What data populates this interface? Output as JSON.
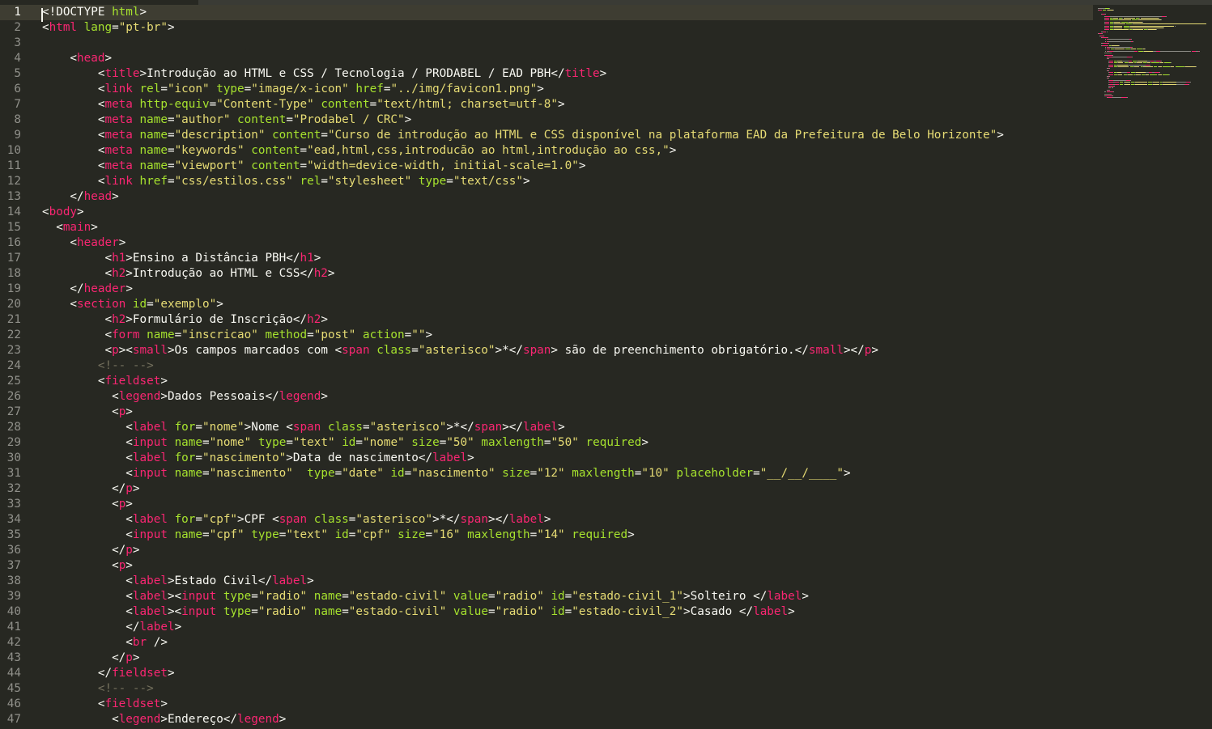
{
  "lines": [
    [
      [
        "t",
        "<!DOCTYPE "
      ],
      [
        "c",
        "html"
      ],
      [
        "t",
        ">"
      ]
    ],
    [
      [
        "t",
        "<"
      ],
      [
        "k",
        "html"
      ],
      [
        "t",
        " "
      ],
      [
        "a",
        "lang"
      ],
      [
        "t",
        "="
      ],
      [
        "s",
        "\"pt-br\""
      ],
      [
        "t",
        ">"
      ]
    ],
    [],
    [
      [
        "t",
        "    <"
      ],
      [
        "k",
        "head"
      ],
      [
        "t",
        ">"
      ]
    ],
    [
      [
        "t",
        "        <"
      ],
      [
        "k",
        "title"
      ],
      [
        "t",
        ">Introdução ao HTML e CSS / Tecnologia / PRODABEL / EAD PBH</"
      ],
      [
        "k",
        "title"
      ],
      [
        "t",
        ">"
      ]
    ],
    [
      [
        "t",
        "        <"
      ],
      [
        "k",
        "link"
      ],
      [
        "t",
        " "
      ],
      [
        "a",
        "rel"
      ],
      [
        "t",
        "="
      ],
      [
        "s",
        "\"icon\""
      ],
      [
        "t",
        " "
      ],
      [
        "a",
        "type"
      ],
      [
        "t",
        "="
      ],
      [
        "s",
        "\"image/x-icon\""
      ],
      [
        "t",
        " "
      ],
      [
        "a",
        "href"
      ],
      [
        "t",
        "="
      ],
      [
        "s",
        "\"../img/favicon1.png\""
      ],
      [
        "t",
        ">"
      ]
    ],
    [
      [
        "t",
        "        <"
      ],
      [
        "k",
        "meta"
      ],
      [
        "t",
        " "
      ],
      [
        "a",
        "http-equiv"
      ],
      [
        "t",
        "="
      ],
      [
        "s",
        "\"Content-Type\""
      ],
      [
        "t",
        " "
      ],
      [
        "a",
        "content"
      ],
      [
        "t",
        "="
      ],
      [
        "s",
        "\"text/html; charset=utf-8\""
      ],
      [
        "t",
        ">"
      ]
    ],
    [
      [
        "t",
        "        <"
      ],
      [
        "k",
        "meta"
      ],
      [
        "t",
        " "
      ],
      [
        "a",
        "name"
      ],
      [
        "t",
        "="
      ],
      [
        "s",
        "\"author\""
      ],
      [
        "t",
        " "
      ],
      [
        "a",
        "content"
      ],
      [
        "t",
        "="
      ],
      [
        "s",
        "\"Prodabel / CRC\""
      ],
      [
        "t",
        ">"
      ]
    ],
    [
      [
        "t",
        "        <"
      ],
      [
        "k",
        "meta"
      ],
      [
        "t",
        " "
      ],
      [
        "a",
        "name"
      ],
      [
        "t",
        "="
      ],
      [
        "s",
        "\"description\""
      ],
      [
        "t",
        " "
      ],
      [
        "a",
        "content"
      ],
      [
        "t",
        "="
      ],
      [
        "s",
        "\"Curso de introdução ao HTML e CSS disponível na plataforma EAD da Prefeitura de Belo Horizonte\""
      ],
      [
        "t",
        ">"
      ]
    ],
    [
      [
        "t",
        "        <"
      ],
      [
        "k",
        "meta"
      ],
      [
        "t",
        " "
      ],
      [
        "a",
        "name"
      ],
      [
        "t",
        "="
      ],
      [
        "s",
        "\"keywords\""
      ],
      [
        "t",
        " "
      ],
      [
        "a",
        "content"
      ],
      [
        "t",
        "="
      ],
      [
        "s",
        "\"ead,html,css,introducão ao html,introdução ao css,\""
      ],
      [
        "t",
        ">"
      ]
    ],
    [
      [
        "t",
        "        <"
      ],
      [
        "k",
        "meta"
      ],
      [
        "t",
        " "
      ],
      [
        "a",
        "name"
      ],
      [
        "t",
        "="
      ],
      [
        "s",
        "\"viewport\""
      ],
      [
        "t",
        " "
      ],
      [
        "a",
        "content"
      ],
      [
        "t",
        "="
      ],
      [
        "s",
        "\"width=device-width, initial-scale=1.0\""
      ],
      [
        "t",
        ">"
      ]
    ],
    [
      [
        "t",
        "        <"
      ],
      [
        "k",
        "link"
      ],
      [
        "t",
        " "
      ],
      [
        "a",
        "href"
      ],
      [
        "t",
        "="
      ],
      [
        "s",
        "\"css/estilos.css\""
      ],
      [
        "t",
        " "
      ],
      [
        "a",
        "rel"
      ],
      [
        "t",
        "="
      ],
      [
        "s",
        "\"stylesheet\""
      ],
      [
        "t",
        " "
      ],
      [
        "a",
        "type"
      ],
      [
        "t",
        "="
      ],
      [
        "s",
        "\"text/css\""
      ],
      [
        "t",
        ">"
      ]
    ],
    [
      [
        "t",
        "    </"
      ],
      [
        "k",
        "head"
      ],
      [
        "t",
        ">"
      ]
    ],
    [
      [
        "t",
        "<"
      ],
      [
        "k",
        "body"
      ],
      [
        "t",
        ">"
      ]
    ],
    [
      [
        "t",
        "  <"
      ],
      [
        "k",
        "main"
      ],
      [
        "t",
        ">"
      ]
    ],
    [
      [
        "t",
        "    <"
      ],
      [
        "k",
        "header"
      ],
      [
        "t",
        ">"
      ]
    ],
    [
      [
        "t",
        "         <"
      ],
      [
        "k",
        "h1"
      ],
      [
        "t",
        ">Ensino a Distância PBH</"
      ],
      [
        "k",
        "h1"
      ],
      [
        "t",
        ">"
      ]
    ],
    [
      [
        "t",
        "         <"
      ],
      [
        "k",
        "h2"
      ],
      [
        "t",
        ">Introdução ao HTML e CSS</"
      ],
      [
        "k",
        "h2"
      ],
      [
        "t",
        ">"
      ]
    ],
    [
      [
        "t",
        "    </"
      ],
      [
        "k",
        "header"
      ],
      [
        "t",
        ">"
      ]
    ],
    [
      [
        "t",
        "    <"
      ],
      [
        "k",
        "section"
      ],
      [
        "t",
        " "
      ],
      [
        "a",
        "id"
      ],
      [
        "t",
        "="
      ],
      [
        "s",
        "\"exemplo\""
      ],
      [
        "t",
        ">"
      ]
    ],
    [
      [
        "t",
        "         <"
      ],
      [
        "k",
        "h2"
      ],
      [
        "t",
        ">Formulário de Inscrição</"
      ],
      [
        "k",
        "h2"
      ],
      [
        "t",
        ">"
      ]
    ],
    [
      [
        "t",
        "         <"
      ],
      [
        "k",
        "form"
      ],
      [
        "t",
        " "
      ],
      [
        "a",
        "name"
      ],
      [
        "t",
        "="
      ],
      [
        "s",
        "\"inscricao\""
      ],
      [
        "t",
        " "
      ],
      [
        "a",
        "method"
      ],
      [
        "t",
        "="
      ],
      [
        "s",
        "\"post\""
      ],
      [
        "t",
        " "
      ],
      [
        "a",
        "action"
      ],
      [
        "t",
        "="
      ],
      [
        "s",
        "\"\""
      ],
      [
        "t",
        ">"
      ]
    ],
    [
      [
        "t",
        "         <"
      ],
      [
        "k",
        "p"
      ],
      [
        "t",
        "><"
      ],
      [
        "k",
        "small"
      ],
      [
        "t",
        ">Os campos marcados com <"
      ],
      [
        "k",
        "span"
      ],
      [
        "t",
        " "
      ],
      [
        "a",
        "class"
      ],
      [
        "t",
        "="
      ],
      [
        "s",
        "\"asterisco\""
      ],
      [
        "t",
        ">*</"
      ],
      [
        "k",
        "span"
      ],
      [
        "t",
        "> são de preenchimento obrigatório.</"
      ],
      [
        "k",
        "small"
      ],
      [
        "t",
        "></"
      ],
      [
        "k",
        "p"
      ],
      [
        "t",
        ">"
      ]
    ],
    [
      [
        "m",
        "        <!-- -->"
      ]
    ],
    [
      [
        "t",
        "        <"
      ],
      [
        "k",
        "fieldset"
      ],
      [
        "t",
        ">"
      ]
    ],
    [
      [
        "t",
        "          <"
      ],
      [
        "k",
        "legend"
      ],
      [
        "t",
        ">Dados Pessoais</"
      ],
      [
        "k",
        "legend"
      ],
      [
        "t",
        ">"
      ]
    ],
    [
      [
        "t",
        "          <"
      ],
      [
        "k",
        "p"
      ],
      [
        "t",
        ">"
      ]
    ],
    [
      [
        "t",
        "            <"
      ],
      [
        "k",
        "label"
      ],
      [
        "t",
        " "
      ],
      [
        "a",
        "for"
      ],
      [
        "t",
        "="
      ],
      [
        "s",
        "\"nome\""
      ],
      [
        "t",
        ">Nome <"
      ],
      [
        "k",
        "span"
      ],
      [
        "t",
        " "
      ],
      [
        "a",
        "class"
      ],
      [
        "t",
        "="
      ],
      [
        "s",
        "\"asterisco\""
      ],
      [
        "t",
        ">*</"
      ],
      [
        "k",
        "span"
      ],
      [
        "t",
        "></"
      ],
      [
        "k",
        "label"
      ],
      [
        "t",
        ">"
      ]
    ],
    [
      [
        "t",
        "            <"
      ],
      [
        "k",
        "input"
      ],
      [
        "t",
        " "
      ],
      [
        "a",
        "name"
      ],
      [
        "t",
        "="
      ],
      [
        "s",
        "\"nome\""
      ],
      [
        "t",
        " "
      ],
      [
        "a",
        "type"
      ],
      [
        "t",
        "="
      ],
      [
        "s",
        "\"text\""
      ],
      [
        "t",
        " "
      ],
      [
        "a",
        "id"
      ],
      [
        "t",
        "="
      ],
      [
        "s",
        "\"nome\""
      ],
      [
        "t",
        " "
      ],
      [
        "a",
        "size"
      ],
      [
        "t",
        "="
      ],
      [
        "s",
        "\"50\""
      ],
      [
        "t",
        " "
      ],
      [
        "a",
        "maxlength"
      ],
      [
        "t",
        "="
      ],
      [
        "s",
        "\"50\""
      ],
      [
        "t",
        " "
      ],
      [
        "a",
        "required"
      ],
      [
        "t",
        ">"
      ]
    ],
    [
      [
        "t",
        "            <"
      ],
      [
        "k",
        "label"
      ],
      [
        "t",
        " "
      ],
      [
        "a",
        "for"
      ],
      [
        "t",
        "="
      ],
      [
        "s",
        "\"nascimento\""
      ],
      [
        "t",
        ">Data de nascimento</"
      ],
      [
        "k",
        "label"
      ],
      [
        "t",
        ">"
      ]
    ],
    [
      [
        "t",
        "            <"
      ],
      [
        "k",
        "input"
      ],
      [
        "t",
        " "
      ],
      [
        "a",
        "name"
      ],
      [
        "t",
        "="
      ],
      [
        "s",
        "\"nascimento\""
      ],
      [
        "t",
        "  "
      ],
      [
        "a",
        "type"
      ],
      [
        "t",
        "="
      ],
      [
        "s",
        "\"date\""
      ],
      [
        "t",
        " "
      ],
      [
        "a",
        "id"
      ],
      [
        "t",
        "="
      ],
      [
        "s",
        "\"nascimento\""
      ],
      [
        "t",
        " "
      ],
      [
        "a",
        "size"
      ],
      [
        "t",
        "="
      ],
      [
        "s",
        "\"12\""
      ],
      [
        "t",
        " "
      ],
      [
        "a",
        "maxlength"
      ],
      [
        "t",
        "="
      ],
      [
        "s",
        "\"10\""
      ],
      [
        "t",
        " "
      ],
      [
        "a",
        "placeholder"
      ],
      [
        "t",
        "="
      ],
      [
        "s",
        "\"__/__/____\""
      ],
      [
        "t",
        ">"
      ]
    ],
    [
      [
        "t",
        "          </"
      ],
      [
        "k",
        "p"
      ],
      [
        "t",
        ">"
      ]
    ],
    [
      [
        "t",
        "          <"
      ],
      [
        "k",
        "p"
      ],
      [
        "t",
        ">"
      ]
    ],
    [
      [
        "t",
        "            <"
      ],
      [
        "k",
        "label"
      ],
      [
        "t",
        " "
      ],
      [
        "a",
        "for"
      ],
      [
        "t",
        "="
      ],
      [
        "s",
        "\"cpf\""
      ],
      [
        "t",
        ">CPF <"
      ],
      [
        "k",
        "span"
      ],
      [
        "t",
        " "
      ],
      [
        "a",
        "class"
      ],
      [
        "t",
        "="
      ],
      [
        "s",
        "\"asterisco\""
      ],
      [
        "t",
        ">*</"
      ],
      [
        "k",
        "span"
      ],
      [
        "t",
        "></"
      ],
      [
        "k",
        "label"
      ],
      [
        "t",
        ">"
      ]
    ],
    [
      [
        "t",
        "            <"
      ],
      [
        "k",
        "input"
      ],
      [
        "t",
        " "
      ],
      [
        "a",
        "name"
      ],
      [
        "t",
        "="
      ],
      [
        "s",
        "\"cpf\""
      ],
      [
        "t",
        " "
      ],
      [
        "a",
        "type"
      ],
      [
        "t",
        "="
      ],
      [
        "s",
        "\"text\""
      ],
      [
        "t",
        " "
      ],
      [
        "a",
        "id"
      ],
      [
        "t",
        "="
      ],
      [
        "s",
        "\"cpf\""
      ],
      [
        "t",
        " "
      ],
      [
        "a",
        "size"
      ],
      [
        "t",
        "="
      ],
      [
        "s",
        "\"16\""
      ],
      [
        "t",
        " "
      ],
      [
        "a",
        "maxlength"
      ],
      [
        "t",
        "="
      ],
      [
        "s",
        "\"14\""
      ],
      [
        "t",
        " "
      ],
      [
        "a",
        "required"
      ],
      [
        "t",
        ">"
      ]
    ],
    [
      [
        "t",
        "          </"
      ],
      [
        "k",
        "p"
      ],
      [
        "t",
        ">"
      ]
    ],
    [
      [
        "t",
        "          <"
      ],
      [
        "k",
        "p"
      ],
      [
        "t",
        ">"
      ]
    ],
    [
      [
        "t",
        "            <"
      ],
      [
        "k",
        "label"
      ],
      [
        "t",
        ">Estado Civil</"
      ],
      [
        "k",
        "label"
      ],
      [
        "t",
        ">"
      ]
    ],
    [
      [
        "t",
        "            <"
      ],
      [
        "k",
        "label"
      ],
      [
        "t",
        "><"
      ],
      [
        "k",
        "input"
      ],
      [
        "t",
        " "
      ],
      [
        "a",
        "type"
      ],
      [
        "t",
        "="
      ],
      [
        "s",
        "\"radio\""
      ],
      [
        "t",
        " "
      ],
      [
        "a",
        "name"
      ],
      [
        "t",
        "="
      ],
      [
        "s",
        "\"estado-civil\""
      ],
      [
        "t",
        " "
      ],
      [
        "a",
        "value"
      ],
      [
        "t",
        "="
      ],
      [
        "s",
        "\"radio\""
      ],
      [
        "t",
        " "
      ],
      [
        "a",
        "id"
      ],
      [
        "t",
        "="
      ],
      [
        "s",
        "\"estado-civil_1\""
      ],
      [
        "t",
        ">Solteiro </"
      ],
      [
        "k",
        "label"
      ],
      [
        "t",
        ">"
      ]
    ],
    [
      [
        "t",
        "            <"
      ],
      [
        "k",
        "label"
      ],
      [
        "t",
        "><"
      ],
      [
        "k",
        "input"
      ],
      [
        "t",
        " "
      ],
      [
        "a",
        "type"
      ],
      [
        "t",
        "="
      ],
      [
        "s",
        "\"radio\""
      ],
      [
        "t",
        " "
      ],
      [
        "a",
        "name"
      ],
      [
        "t",
        "="
      ],
      [
        "s",
        "\"estado-civil\""
      ],
      [
        "t",
        " "
      ],
      [
        "a",
        "value"
      ],
      [
        "t",
        "="
      ],
      [
        "s",
        "\"radio\""
      ],
      [
        "t",
        " "
      ],
      [
        "a",
        "id"
      ],
      [
        "t",
        "="
      ],
      [
        "s",
        "\"estado-civil_2\""
      ],
      [
        "t",
        ">Casado </"
      ],
      [
        "k",
        "label"
      ],
      [
        "t",
        ">"
      ]
    ],
    [
      [
        "t",
        "            </"
      ],
      [
        "k",
        "label"
      ],
      [
        "t",
        ">"
      ]
    ],
    [
      [
        "t",
        "            <"
      ],
      [
        "k",
        "br"
      ],
      [
        "t",
        " />"
      ]
    ],
    [
      [
        "t",
        "          </"
      ],
      [
        "k",
        "p"
      ],
      [
        "t",
        ">"
      ]
    ],
    [
      [
        "t",
        "        </"
      ],
      [
        "k",
        "fieldset"
      ],
      [
        "t",
        ">"
      ]
    ],
    [
      [
        "m",
        "        <!-- -->"
      ]
    ],
    [
      [
        "t",
        "        <"
      ],
      [
        "k",
        "fieldset"
      ],
      [
        "t",
        ">"
      ]
    ],
    [
      [
        "t",
        "          <"
      ],
      [
        "k",
        "legend"
      ],
      [
        "t",
        ">Endereço</"
      ],
      [
        "k",
        "legend"
      ],
      [
        "t",
        ">"
      ]
    ]
  ],
  "current_line": 1,
  "colors": {
    "background": "#272822",
    "text": "#f8f8f2",
    "tag": "#f92672",
    "attribute": "#a6e22e",
    "string": "#e6db74",
    "comment": "#75715e",
    "line_number": "#90908a"
  }
}
